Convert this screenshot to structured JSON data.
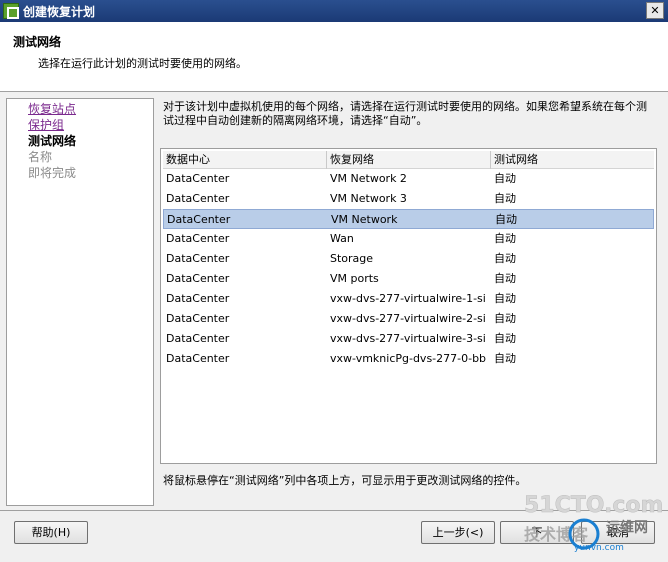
{
  "window": {
    "title": "创建恢复计划"
  },
  "header": {
    "title": "测试网络",
    "subtitle": "选择在运行此计划的测试时要使用的网络。"
  },
  "nav": [
    {
      "label": "恢复站点",
      "state": "link"
    },
    {
      "label": "保护组",
      "state": "link"
    },
    {
      "label": "测试网络",
      "state": "current"
    },
    {
      "label": "名称",
      "state": "disabled"
    },
    {
      "label": "即将完成",
      "state": "disabled"
    }
  ],
  "description": "对于该计划中虚拟机使用的每个网络，请选择在运行测试时要使用的网络。如果您希望系统在每个测试过程中自动创建新的隔离网络环境，请选择“自动”。",
  "table": {
    "columns": [
      "数据中心",
      "恢复网络",
      "测试网络"
    ],
    "rows": [
      [
        "DataCenter",
        "VM Network 2",
        "自动"
      ],
      [
        "DataCenter",
        "VM Network 3",
        "自动"
      ],
      [
        "DataCenter",
        "VM Network",
        "自动"
      ],
      [
        "DataCenter",
        "Wan",
        "自动"
      ],
      [
        "DataCenter",
        "Storage",
        "自动"
      ],
      [
        "DataCenter",
        "VM ports",
        "自动"
      ],
      [
        "DataCenter",
        "vxw-dvs-277-virtualwire-1-si...",
        "自动"
      ],
      [
        "DataCenter",
        "vxw-dvs-277-virtualwire-2-si...",
        "自动"
      ],
      [
        "DataCenter",
        "vxw-dvs-277-virtualwire-3-si...",
        "自动"
      ],
      [
        "DataCenter",
        "vxw-vmknicPg-dvs-277-0-bb...",
        "自动"
      ]
    ],
    "selected_index": 2
  },
  "hint": "将鼠标悬停在“测试网络”列中各项上方，可显示用于更改测试网络的控件。",
  "buttons": {
    "help": "帮助(H)",
    "back": "上一步(<)",
    "next": "下",
    "cancel": "取消"
  },
  "watermark": {
    "site": "51CTO.com",
    "text": "技术博客",
    "brand": "运维网",
    "url": "yunvn.com"
  },
  "colors": {
    "selected_row": "#b9cde8",
    "link": "#7b2a8e",
    "title_bar": "#1b3a75"
  }
}
